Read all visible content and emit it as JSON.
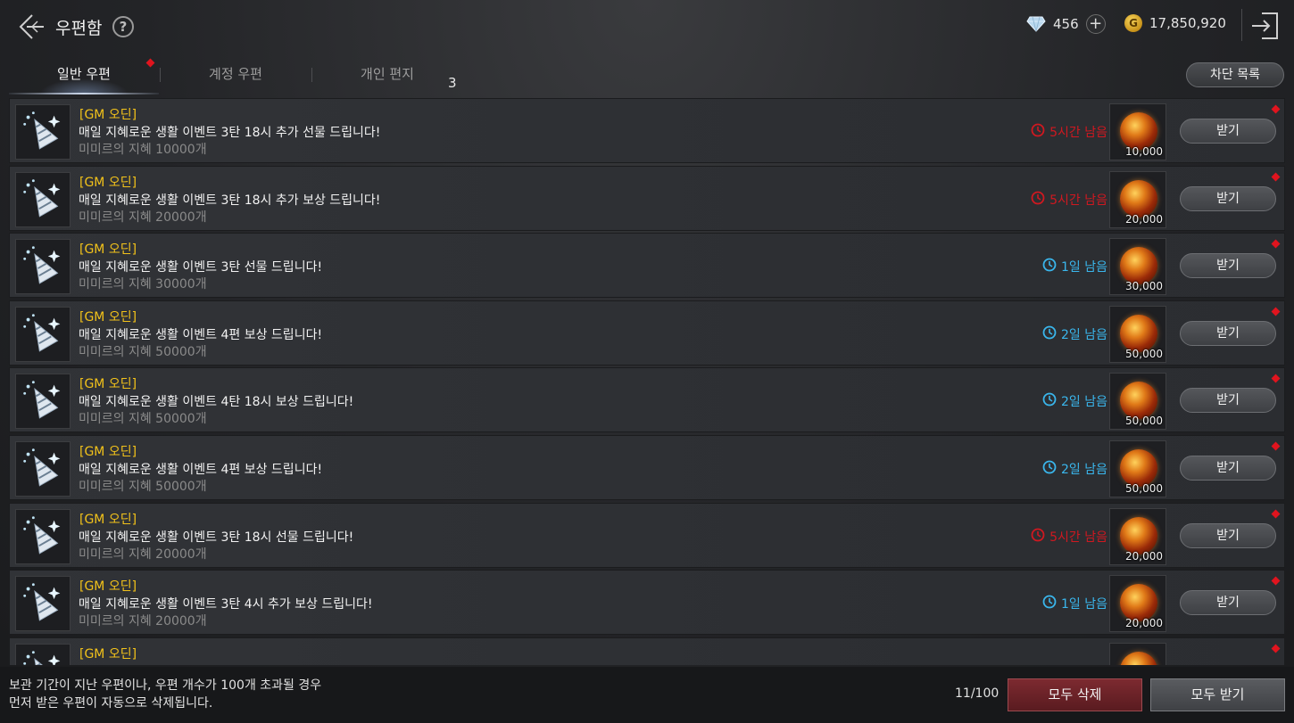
{
  "header": {
    "title": "우편함",
    "help": "?",
    "diamond_count": "456",
    "gold_count": "17,850,920",
    "gold_symbol": "G"
  },
  "tabs": [
    {
      "label": "일반 우편",
      "active": true,
      "has_dot": true
    },
    {
      "label": "계정 우편",
      "active": false,
      "has_dot": false
    },
    {
      "label": "개인 편지",
      "active": false,
      "has_dot": false
    }
  ],
  "tab_count": "3",
  "block_list_label": "차단 목록",
  "colors": {
    "sender": "#f2c21a",
    "timer_red": "#d01820",
    "timer_blue": "#3ab6ec",
    "notification_dot": "#e0141e"
  },
  "mails": [
    {
      "sender": "[GM 오딘]",
      "subject": "매일 지혜로운 생활 이벤트 3탄 18시 추가 선물 드립니다!",
      "desc": "미미르의 지혜 10000개",
      "timer": "5시간 남음",
      "timer_color": "red",
      "qty": "10,000",
      "button": "받기"
    },
    {
      "sender": "[GM 오딘]",
      "subject": "매일 지혜로운 생활 이벤트 3탄 18시 추가 보상 드립니다!",
      "desc": "미미르의 지혜 20000개",
      "timer": "5시간 남음",
      "timer_color": "red",
      "qty": "20,000",
      "button": "받기"
    },
    {
      "sender": "[GM 오딘]",
      "subject": "매일 지혜로운 생활 이벤트 3탄 선물 드립니다!",
      "desc": "미미르의 지혜 30000개",
      "timer": "1일 남음",
      "timer_color": "blue",
      "qty": "30,000",
      "button": "받기"
    },
    {
      "sender": "[GM 오딘]",
      "subject": "매일 지혜로운 생활 이벤트 4편 보상 드립니다!",
      "desc": "미미르의 지혜 50000개",
      "timer": "2일 남음",
      "timer_color": "blue",
      "qty": "50,000",
      "button": "받기"
    },
    {
      "sender": "[GM 오딘]",
      "subject": "매일 지혜로운 생활 이벤트 4탄 18시 보상 드립니다!",
      "desc": "미미르의 지혜 50000개",
      "timer": "2일 남음",
      "timer_color": "blue",
      "qty": "50,000",
      "button": "받기"
    },
    {
      "sender": "[GM 오딘]",
      "subject": "매일 지혜로운 생활 이벤트 4편 보상 드립니다!",
      "desc": "미미르의 지혜 50000개",
      "timer": "2일 남음",
      "timer_color": "blue",
      "qty": "50,000",
      "button": "받기"
    },
    {
      "sender": "[GM 오딘]",
      "subject": "매일 지혜로운 생활 이벤트 3탄 18시 선물 드립니다!",
      "desc": "미미르의 지혜 20000개",
      "timer": "5시간 남음",
      "timer_color": "red",
      "qty": "20,000",
      "button": "받기"
    },
    {
      "sender": "[GM 오딘]",
      "subject": "매일 지혜로운 생활 이벤트 3탄 4시 추가 보상 드립니다!",
      "desc": "미미르의 지혜 20000개",
      "timer": "1일 남음",
      "timer_color": "blue",
      "qty": "20,000",
      "button": "받기"
    },
    {
      "sender": "[GM 오딘]",
      "subject": "",
      "desc": "",
      "timer": "",
      "timer_color": "blue",
      "qty": "",
      "button": ""
    }
  ],
  "footer": {
    "notice_line1": "보관 기간이 지난 우편이나, 우편 개수가 100개 초과될 경우",
    "notice_line2": "먼저 받은 우편이 자동으로 삭제됩니다.",
    "page_count": "11/100",
    "delete_all": "모두 삭제",
    "receive_all": "모두 받기"
  }
}
